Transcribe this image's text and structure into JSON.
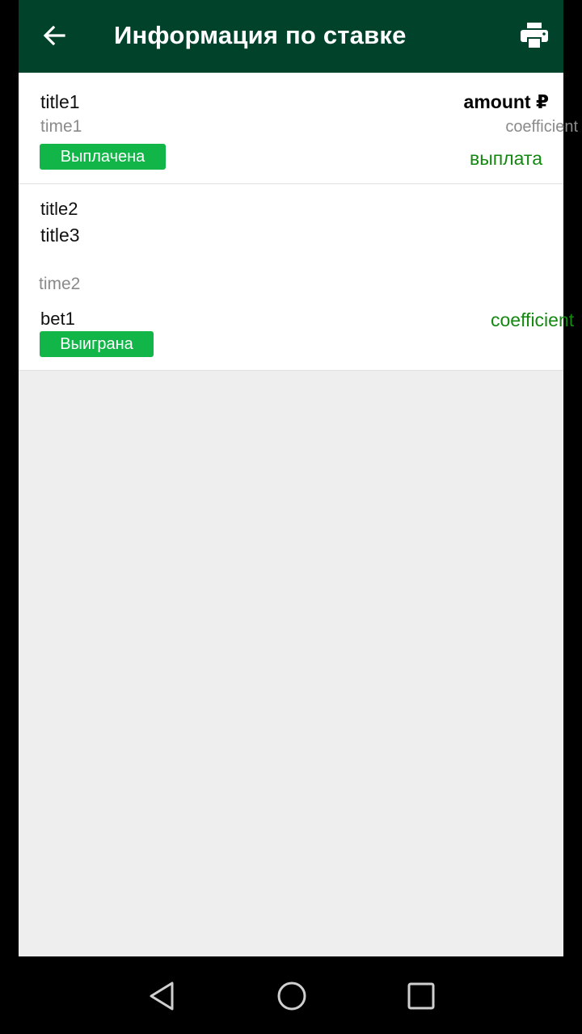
{
  "header": {
    "title": "Информация по ставке",
    "back_icon": "arrow-left-icon",
    "print_icon": "printer-icon",
    "background": "#00432a"
  },
  "bet_summary": {
    "title": "title1",
    "time": "time1",
    "amount": "amount ₽",
    "coefficient": "coefficient",
    "status": "Выплачена",
    "payout": "выплата"
  },
  "event": {
    "title_a": "title2",
    "title_b": "title3",
    "time": "time2",
    "bet": "bet1",
    "coefficient": "coefficient",
    "status": "Выиграна"
  },
  "colors": {
    "accent_green": "#12b548",
    "text_green": "#13880f"
  },
  "system_nav": {
    "back_icon": "triangle-back-icon",
    "home_icon": "circle-home-icon",
    "recents_icon": "square-recents-icon"
  }
}
